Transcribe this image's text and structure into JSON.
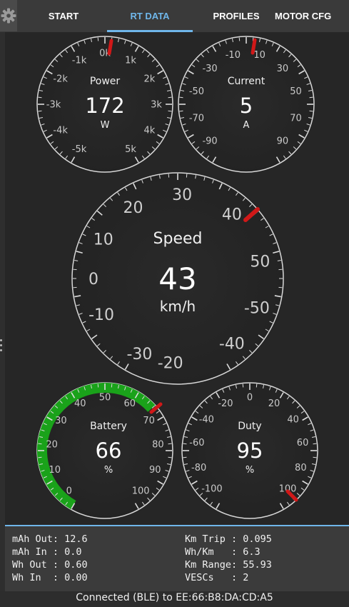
{
  "tabs": [
    {
      "label": "START"
    },
    {
      "label": "RT DATA"
    },
    {
      "label": "PROFILES"
    },
    {
      "label": "MOTOR CFG"
    }
  ],
  "colors": {
    "accent": "#6fb6ea",
    "needle": "#d01818",
    "battery_arc": "#1aa21a"
  },
  "gauges": {
    "power": {
      "title": "Power",
      "value": "172",
      "unit": "W",
      "labels": [
        "-5k",
        "-4k",
        "-3k",
        "-2k",
        "-1k",
        "0k",
        "1k",
        "2k",
        "3k",
        "4k",
        "5k"
      ],
      "min": -5000,
      "max": 5000,
      "level": 172
    },
    "current": {
      "title": "Current",
      "value": "5",
      "unit": "A",
      "labels": [
        "-90",
        "-70",
        "-50",
        "-30",
        "-10",
        "10",
        "30",
        "50",
        "70",
        "90"
      ],
      "min": -100,
      "max": 100,
      "level": 5
    },
    "speed": {
      "title": "Speed",
      "value": "43",
      "unit": "km/h",
      "labels": [
        "-30",
        "-20",
        "-10",
        "0",
        "10",
        "20",
        "30",
        "40",
        "50",
        "-50",
        "-40"
      ],
      "level": 43
    },
    "battery": {
      "title": "Battery",
      "value": "66",
      "unit": "%",
      "labels": [
        "0",
        "10",
        "20",
        "30",
        "40",
        "50",
        "60",
        "70",
        "80",
        "90",
        "100"
      ],
      "min": 0,
      "max": 100,
      "level": 66
    },
    "duty": {
      "title": "Duty",
      "value": "95",
      "unit": "%",
      "labels": [
        "-100",
        "-80",
        "-60",
        "-40",
        "-20",
        "0",
        "20",
        "40",
        "60",
        "80",
        "100"
      ],
      "min": -100,
      "max": 100,
      "level": 95
    }
  },
  "stats": {
    "mah_out": "mAh Out: 12.6",
    "mah_in": "mAh In : 0.0",
    "wh_out": "Wh Out : 0.60",
    "wh_in": "Wh In  : 0.00",
    "km_trip": "Km Trip : 0.095",
    "wh_km": "Wh/Km   : 6.3",
    "km_range": "Km Range: 55.93",
    "vescs": "VESCs   : 2"
  },
  "status": "Connected (BLE) to EE:66:B8:DA:CD:A5"
}
